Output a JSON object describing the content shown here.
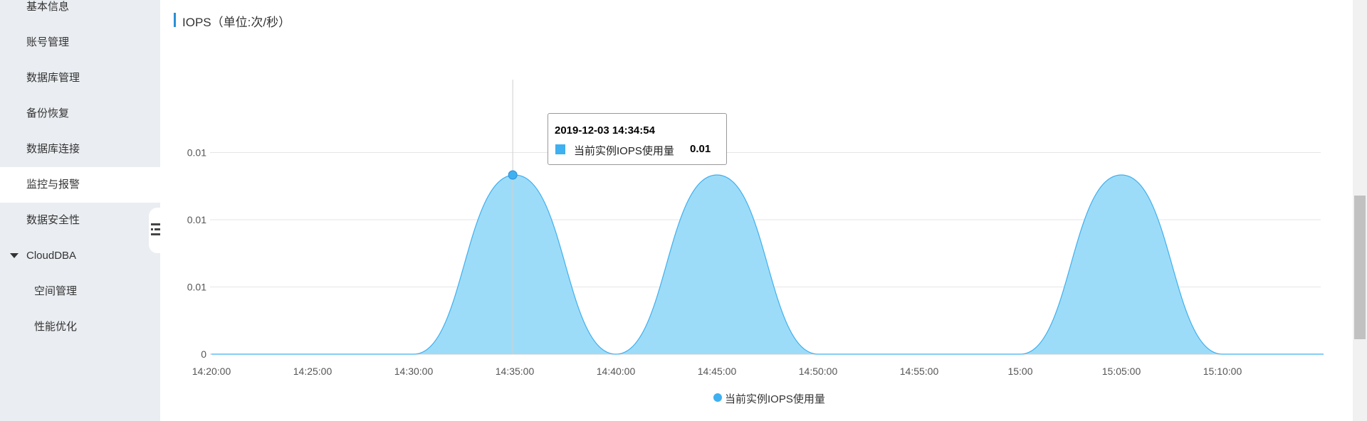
{
  "sidebar": {
    "items": [
      {
        "label": "基本信息"
      },
      {
        "label": "账号管理"
      },
      {
        "label": "数据库管理"
      },
      {
        "label": "备份恢复"
      },
      {
        "label": "数据库连接"
      },
      {
        "label": "监控与报警",
        "active": true
      },
      {
        "label": "数据安全性"
      },
      {
        "label": "CloudDBA",
        "expanded": true
      },
      {
        "label": "空间管理"
      },
      {
        "label": "性能优化"
      }
    ],
    "collapse_icon": "collapse-menu-icon"
  },
  "panel": {
    "title": "IOPS（单位:次/秒）"
  },
  "tooltip": {
    "time": "2019-12-03 14:34:54",
    "series_label": "当前实例IOPS使用量",
    "value": "0.01"
  },
  "legend": {
    "label": "当前实例IOPS使用量"
  },
  "colors": {
    "series_line": "#3fb0f0",
    "series_fill": "#9ddcf8",
    "accent": "#2b8fd6"
  },
  "chart_data": {
    "type": "area",
    "title": "IOPS（单位:次/秒）",
    "xlabel": "",
    "ylabel": "",
    "x_tick_labels": [
      "14:20:00",
      "14:25:00",
      "14:30:00",
      "14:35:00",
      "14:40:00",
      "14:45:00",
      "14:50:00",
      "14:55:00",
      "15:00",
      "15:05:00",
      "15:10:00"
    ],
    "y_tick_labels": [
      "0",
      "0.01",
      "0.01",
      "0.01"
    ],
    "ylim": [
      0,
      0.012
    ],
    "grid": true,
    "legend_position": "bottom-center",
    "series": [
      {
        "name": "当前实例IOPS使用量",
        "points": [
          {
            "x": "14:20:00",
            "y": 0
          },
          {
            "x": "14:30:00",
            "y": 0
          },
          {
            "x": "14:35:00",
            "y": 0.008
          },
          {
            "x": "14:40:00",
            "y": 0
          },
          {
            "x": "14:45:00",
            "y": 0.008
          },
          {
            "x": "14:50:00",
            "y": 0
          },
          {
            "x": "15:00",
            "y": 0
          },
          {
            "x": "15:05:00",
            "y": 0.008
          },
          {
            "x": "15:10:00",
            "y": 0
          },
          {
            "x": "15:15:00",
            "y": 0
          }
        ]
      }
    ],
    "highlight": {
      "x": "14:34:54",
      "y": 0.01
    }
  }
}
